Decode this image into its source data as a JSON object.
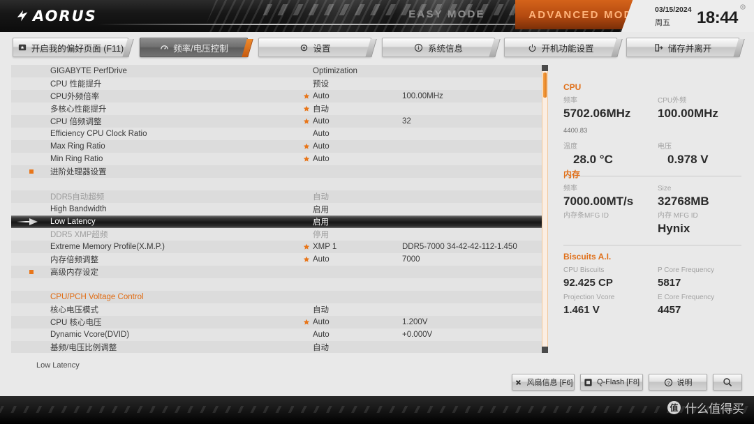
{
  "header": {
    "logo_text": "AORUS",
    "easy_mode": "EASY MODE",
    "advanced_mode": "ADVANCED MODE",
    "date": "03/15/2024",
    "weekday": "周五",
    "time": "18:44",
    "accent_color": "#e0701a"
  },
  "nav": {
    "tabs": [
      {
        "label": "开启我的偏好页面 (F11)",
        "icon": "star-box-icon",
        "active": false
      },
      {
        "label": "频率/电压控制",
        "icon": "gauge-icon",
        "active": true
      },
      {
        "label": "设置",
        "icon": "gear-icon",
        "active": false
      },
      {
        "label": "系统信息",
        "icon": "info-icon",
        "active": false
      },
      {
        "label": "开机功能设置",
        "icon": "power-icon",
        "active": false
      },
      {
        "label": "储存并离开",
        "icon": "exit-icon",
        "active": false
      }
    ]
  },
  "settings_rows": [
    {
      "label": "GIGABYTE PerfDrive",
      "value": "Optimization",
      "value2": "",
      "star": false,
      "marker": false,
      "state": "normal"
    },
    {
      "label": "CPU 性能提升",
      "value": "预设",
      "value2": "",
      "star": false,
      "marker": false,
      "state": "normal"
    },
    {
      "label": "CPU外频倍率",
      "value": "Auto",
      "value2": "100.00MHz",
      "star": true,
      "marker": false,
      "state": "normal"
    },
    {
      "label": "多核心性能提升",
      "value": "自动",
      "value2": "",
      "star": true,
      "marker": false,
      "state": "normal"
    },
    {
      "label": "CPU 倍频调整",
      "value": "Auto",
      "value2": "32",
      "star": true,
      "marker": false,
      "state": "normal"
    },
    {
      "label": "Efficiency CPU Clock Ratio",
      "value": "Auto",
      "value2": "",
      "star": false,
      "marker": false,
      "state": "normal"
    },
    {
      "label": "Max Ring Ratio",
      "value": "Auto",
      "value2": "",
      "star": true,
      "marker": false,
      "state": "normal"
    },
    {
      "label": "Min Ring Ratio",
      "value": "Auto",
      "value2": "",
      "star": true,
      "marker": false,
      "state": "normal"
    },
    {
      "label": "进阶处理器设置",
      "value": "",
      "value2": "",
      "star": false,
      "marker": true,
      "state": "normal"
    },
    {
      "label": "",
      "value": "",
      "value2": "",
      "star": false,
      "marker": false,
      "state": "spacer"
    },
    {
      "label": "DDR5自动超频",
      "value": "自动",
      "value2": "",
      "star": false,
      "marker": false,
      "state": "dim"
    },
    {
      "label": "High Bandwidth",
      "value": "启用",
      "value2": "",
      "star": false,
      "marker": false,
      "state": "normal"
    },
    {
      "label": "Low Latency",
      "value": "启用",
      "value2": "",
      "star": false,
      "marker": false,
      "state": "selected"
    },
    {
      "label": "DDR5 XMP超频",
      "value": "停用",
      "value2": "",
      "star": false,
      "marker": false,
      "state": "dim"
    },
    {
      "label": "Extreme Memory Profile(X.M.P.)",
      "value": "XMP 1",
      "value2": "DDR5-7000 34-42-42-112-1.450",
      "star": true,
      "marker": false,
      "state": "normal"
    },
    {
      "label": "内存倍频调整",
      "value": "Auto",
      "value2": "7000",
      "star": true,
      "marker": false,
      "state": "normal"
    },
    {
      "label": "高级内存设定",
      "value": "",
      "value2": "",
      "star": false,
      "marker": true,
      "state": "normal"
    },
    {
      "label": "",
      "value": "",
      "value2": "",
      "star": false,
      "marker": false,
      "state": "spacer"
    },
    {
      "label": "CPU/PCH Voltage Control",
      "value": "",
      "value2": "",
      "star": false,
      "marker": false,
      "state": "section"
    },
    {
      "label": "核心电压模式",
      "value": "自动",
      "value2": "",
      "star": false,
      "marker": false,
      "state": "normal"
    },
    {
      "label": "CPU 核心电压",
      "value": "Auto",
      "value2": "1.200V",
      "star": true,
      "marker": false,
      "state": "normal"
    },
    {
      "label": "Dynamic Vcore(DVID)",
      "value": "Auto",
      "value2": "+0.000V",
      "star": false,
      "marker": false,
      "state": "normal"
    },
    {
      "label": "基频/电压比例调整",
      "value": "自动",
      "value2": "",
      "star": false,
      "marker": false,
      "state": "normal"
    }
  ],
  "info_panel": {
    "cpu": {
      "title": "CPU",
      "freq_label": "频率",
      "freq_value": "5702.06MHz",
      "freq_sub": "4400.83",
      "bclk_label": "CPU外频",
      "bclk_value": "100.00MHz",
      "temp_label": "温度",
      "temp_value": "28.0 °C",
      "volt_label": "电压",
      "volt_value": "0.978 V"
    },
    "memory": {
      "title": "内存",
      "freq_label": "频率",
      "freq_value": "7000.00MT/s",
      "size_label": "Size",
      "size_value": "32768MB",
      "dimm_mfg_label": "内存条MFG ID",
      "dimm_mfg_value": "",
      "mem_mfg_label": "内存 MFG ID",
      "mem_mfg_value": "Hynix"
    },
    "ai": {
      "title": "Biscuits A.I.",
      "cpu_biscuits_label": "CPU Biscuits",
      "cpu_biscuits_value": "92.425 CP",
      "p_core_label": "P Core Frequency",
      "p_core_value": "5817",
      "projection_label": "Projection Vcore",
      "projection_value": "1.461 V",
      "e_core_label": "E Core Frequency",
      "e_core_value": "4457"
    }
  },
  "footer": {
    "help_text": "Low Latency",
    "buttons": [
      {
        "label": "风扇信息 [F6]",
        "icon": "fan-icon"
      },
      {
        "label": "Q-Flash [F8]",
        "icon": "chip-icon"
      },
      {
        "label": "说明",
        "icon": "question-icon"
      },
      {
        "label": "",
        "icon": "search-icon"
      }
    ]
  },
  "watermark": {
    "badge": "值",
    "text": "什么值得买"
  }
}
